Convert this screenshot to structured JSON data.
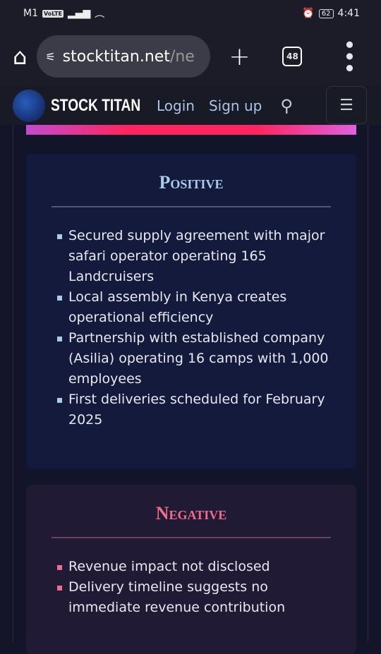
{
  "status": {
    "carrier": "M1",
    "volte": "VoLTE",
    "battery": "62",
    "time": "4:41"
  },
  "browser": {
    "url_host": "stocktitan.net",
    "url_path": "/ne",
    "tab_count": "48"
  },
  "nav": {
    "brand": "STOCK TITAN",
    "login": "Login",
    "signup": "Sign up"
  },
  "positive": {
    "title": "Positive",
    "items": [
      "Secured supply agreement with major safari operator operating 165 Landcruisers",
      "Local assembly in Kenya creates operational efficiency",
      "Partnership with established company (Asilia) operating 16 camps with 1,000 employees",
      "First deliveries scheduled for February 2025"
    ]
  },
  "negative": {
    "title": "Negative",
    "items": [
      "Revenue impact not disclosed",
      "Delivery timeline suggests no immediate revenue contribution"
    ]
  }
}
